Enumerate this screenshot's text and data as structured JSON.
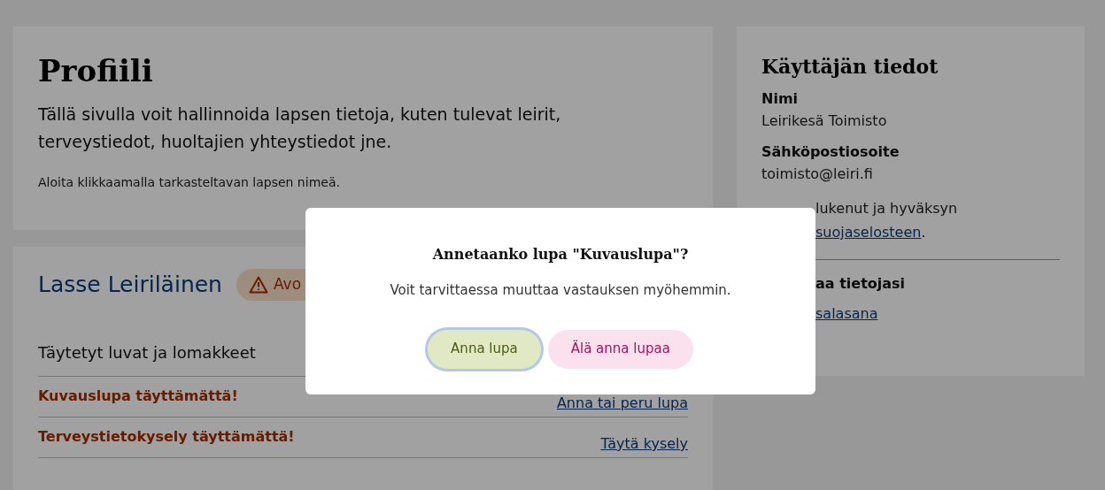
{
  "profile": {
    "title": "Profiili",
    "intro": "Tällä sivulla voit hallinnoida lapsen tietoja, kuten tulevat leirit, terveystiedot, huoltajien yhteystiedot jne.",
    "hint": "Aloita klikkaamalla tarkasteltavan lapsen nimeä."
  },
  "child": {
    "name": "Lasse Leiriläinen",
    "badge": "Avo",
    "section_title": "Täytetyt luvat ja lomakkeet",
    "forms": [
      {
        "label": "Kuvauslupa täyttämättä!",
        "link": "Anna tai peru lupa"
      },
      {
        "label": "Terveystietokysely täyttämättä!",
        "link": "Täytä kysely"
      }
    ]
  },
  "user_info": {
    "title": "Käyttäjän tiedot",
    "fields": [
      {
        "label": "Nimi",
        "value": "Leirikesä Toimisto"
      },
      {
        "label": "Sähköpostiosoite",
        "value": "toimisto@leiri.fi"
      }
    ],
    "consent_text": "lukenut ja hyväksyn",
    "consent_link": "suojaselosteen",
    "consent_end": ".",
    "edit_title": "aa tietojasi",
    "password_link": "salasana"
  },
  "dialog": {
    "title": "Annetaanko lupa \"Kuvauslupa\"?",
    "message": "Voit tarvittaessa muuttaa vastauksen myöhemmin.",
    "buttons": [
      {
        "label": "Anna lupa",
        "kind": "confirm",
        "focused": true
      },
      {
        "label": "Älä anna lupaa",
        "kind": "decline",
        "focused": false
      }
    ]
  }
}
